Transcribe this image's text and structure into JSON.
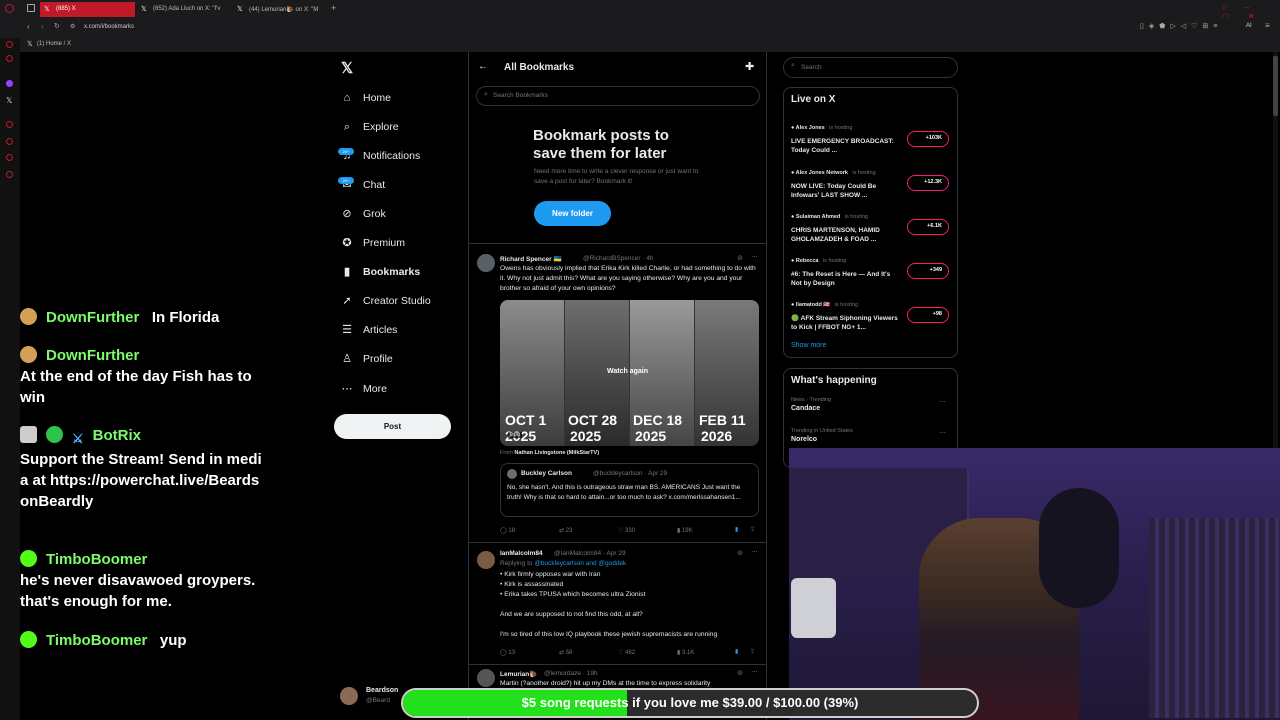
{
  "browser": {
    "tabs": [
      {
        "label": "(885) X",
        "active": true
      },
      {
        "label": "(852) Ada Lluch on X: \"I'v",
        "active": false
      },
      {
        "label": "(44) Lemurian🐌 on X: \"M",
        "active": false
      }
    ],
    "url": "x.com/i/bookmarks",
    "bookmark_bar_item": "(1) Home / X",
    "ai_label": "AI"
  },
  "nav": {
    "items": [
      {
        "label": "Home",
        "icon": "home-icon"
      },
      {
        "label": "Explore",
        "icon": "search-icon"
      },
      {
        "label": "Notifications",
        "icon": "bell-icon",
        "badge": "20+"
      },
      {
        "label": "Chat",
        "icon": "chat-icon",
        "badge": "20+"
      },
      {
        "label": "Grok",
        "icon": "grok-icon"
      },
      {
        "label": "Premium",
        "icon": "premium-icon"
      },
      {
        "label": "Bookmarks",
        "icon": "bookmark-icon",
        "active": true
      },
      {
        "label": "Creator Studio",
        "icon": "rocket-icon"
      },
      {
        "label": "Articles",
        "icon": "articles-icon"
      },
      {
        "label": "Profile",
        "icon": "person-icon"
      },
      {
        "label": "More",
        "icon": "more-icon"
      }
    ],
    "post_label": "Post",
    "account_name": "Beardson",
    "account_handle": "@Beard"
  },
  "main": {
    "header_title": "All Bookmarks",
    "search_placeholder": "Search Bookmarks",
    "empty_title": "Bookmark posts to save them for later",
    "empty_sub": "Need more time to write a clever response or just want to save a post for later? Bookmark it!",
    "new_folder": "New folder",
    "tweets": [
      {
        "name": "Richard Spencer 🇺🇦",
        "handle": "@RichardBSpencer · 4h",
        "text": "Owens has obviously implied that Erika Kirk killed Charlie, or had something to do with it.   Why not just admit this? What are you saying otherwise? Why are you and your brother so afraid of your own opinions?",
        "video_dates": [
          "OCT 1",
          "OCT 28",
          "DEC 18",
          "FEB 11"
        ],
        "video_years": [
          "2025",
          "2025",
          "2025",
          "2026"
        ],
        "watch_again": "Watch again",
        "video_time": "0:00",
        "from": "From ",
        "from_name": "Nathan Livingstone (MilkStarTV)",
        "quote_name": "Buckley Carlson",
        "quote_handle": "@buckleycarlson · Apr 29",
        "quote_text": "No, she hasn't. And this is outrageous straw man BS. AMERICANS Just want the truth! Why is that so hard to attain...or too much to ask? x.com/merlssahansen1...",
        "replies": "18",
        "reposts": "23",
        "likes": "330",
        "views": "19K"
      },
      {
        "name": "IanMalcolm84",
        "handle": "@IanMalcolm84 · Apr 29",
        "replying_prefix": "Replying to ",
        "replying": "@buckleycarlson and @goddek",
        "lines": [
          "• Kirk firmly opposes war with Iran",
          "• Kirk is assassinated",
          "• Erika takes TPUSA which becomes ultra Zionist",
          "",
          "And we are supposed to not find this odd, at all?",
          "",
          "I'm so tired of this low IQ playbook these jewish supremacists are running"
        ],
        "replies": "13",
        "reposts": "58",
        "likes": "482",
        "views": "3.1K"
      },
      {
        "name": "Lemurian🐌",
        "handle": "@lemurdaze · 19h",
        "text": "Martin (?another droid?) hit up my DMs at the time to express solidarity"
      }
    ]
  },
  "right": {
    "search_placeholder": "Search",
    "live_title": "Live on X",
    "is_hosting": "is hosting",
    "live": [
      {
        "host": "Alex Jones",
        "title": "LIVE EMERGENCY BROADCAST: Today Could ...",
        "count": "+103K"
      },
      {
        "host": "Alex Jones Network",
        "title": "NOW LIVE: Today Could Be Infowars' LAST SHOW ...",
        "count": "+12.3K"
      },
      {
        "host": "Sulaiman Ahmed",
        "title": "CHRIS MARTENSON, HAMID GHOLAMZADEH & FOAD ...",
        "count": "+6.1K"
      },
      {
        "host": "Rebecca",
        "title": "#6: The Reset is Here — And It's Not by Design",
        "count": "+349"
      },
      {
        "host": "llamatodd 🇺🇸",
        "title": "🟢 AFK Stream Siphoning Viewers to Kick | FFBOT NG+ 1...",
        "count": "+98"
      }
    ],
    "show_more": "Show more",
    "happening_title": "What's happening",
    "trends": [
      {
        "context": "News · Trending",
        "name": "Candace"
      },
      {
        "context": "Trending in United States",
        "name": "Norelco"
      }
    ]
  },
  "chat": [
    {
      "user": "DownFurther",
      "msg": "In Florida",
      "inline": true
    },
    {
      "user": "DownFurther",
      "msg": "At the end of the day Fish has to win",
      "inline": false
    },
    {
      "user": "BotRix",
      "msg": "Support the Stream! Send in media at https://powerchat.live/BeardsonBeardly",
      "inline": false
    },
    {
      "user": "TimboBoomer",
      "msg": "he's never disavawoed groypers. that's enough for me.",
      "inline": false
    },
    {
      "user": "TimboBoomer",
      "msg": "yup",
      "inline": true
    }
  ],
  "goal": {
    "text": "$5 song requests if you love me $39.00 / $100.00 (39%)",
    "progress": 0.39
  },
  "colors": {
    "accent": "#1d9bf0",
    "live": "#f91880",
    "chat_name": "#7cfc6a",
    "goal": "#22e01a"
  }
}
